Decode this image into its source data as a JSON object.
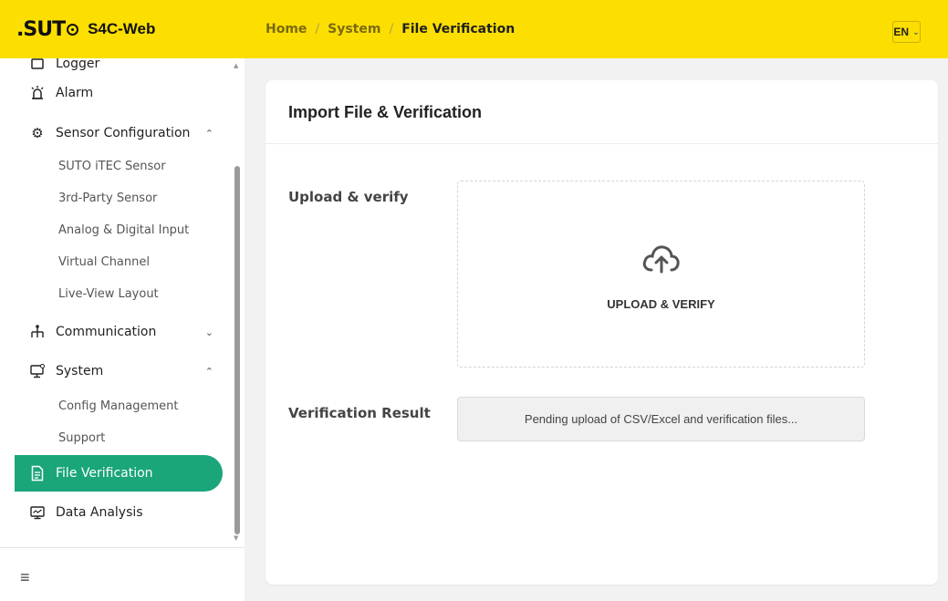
{
  "header": {
    "logo_text": ".SUTO",
    "app_name": "S4C-Web",
    "breadcrumb": [
      "Home",
      "System",
      "File Verification"
    ],
    "separator": "/",
    "language": "EN",
    "accent_color": "#fcdf00"
  },
  "sidebar": {
    "items": [
      {
        "label": "Logger",
        "icon": "logger-icon"
      },
      {
        "label": "Alarm",
        "icon": "alarm-icon"
      },
      {
        "label": "Sensor Configuration",
        "icon": "gear-icon",
        "expanded": true,
        "children": [
          "SUTO iTEC Sensor",
          "3rd-Party Sensor",
          "Analog & Digital Input",
          "Virtual Channel",
          "Live-View Layout"
        ]
      },
      {
        "label": "Communication",
        "icon": "network-icon",
        "expanded": false
      },
      {
        "label": "System",
        "icon": "monitor-icon",
        "expanded": true,
        "children": [
          "Config Management",
          "Support"
        ]
      },
      {
        "label": "File Verification",
        "icon": "file-icon",
        "active": true
      },
      {
        "label": "Data Analysis",
        "icon": "chart-monitor-icon"
      }
    ],
    "active_color": "#1aa57a",
    "menu_icon": "hamburger-icon"
  },
  "main": {
    "title": "Import File & Verification",
    "upload_label": "Upload & verify",
    "upload_button": "UPLOAD & VERIFY",
    "result_label": "Verification Result",
    "result_text": "Pending upload of CSV/Excel and verification files..."
  }
}
